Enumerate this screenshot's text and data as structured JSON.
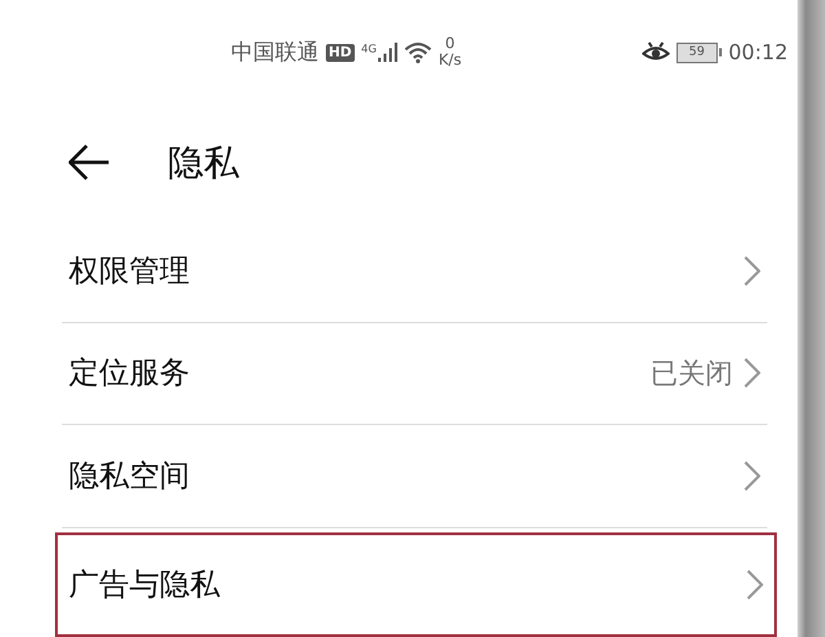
{
  "status_bar": {
    "carrier": "中国联通",
    "hd_badge": "HD",
    "network": "4G",
    "speed_value": "0",
    "speed_unit": "K/s",
    "battery": "59",
    "time": "00:12"
  },
  "header": {
    "title": "隐私"
  },
  "items": [
    {
      "label": "权限管理",
      "highlighted": false
    },
    {
      "label": "定位服务",
      "value": "已关闭",
      "highlighted": false
    },
    {
      "label": "隐私空间",
      "highlighted": false
    },
    {
      "label": "广告与隐私",
      "highlighted": true
    }
  ]
}
